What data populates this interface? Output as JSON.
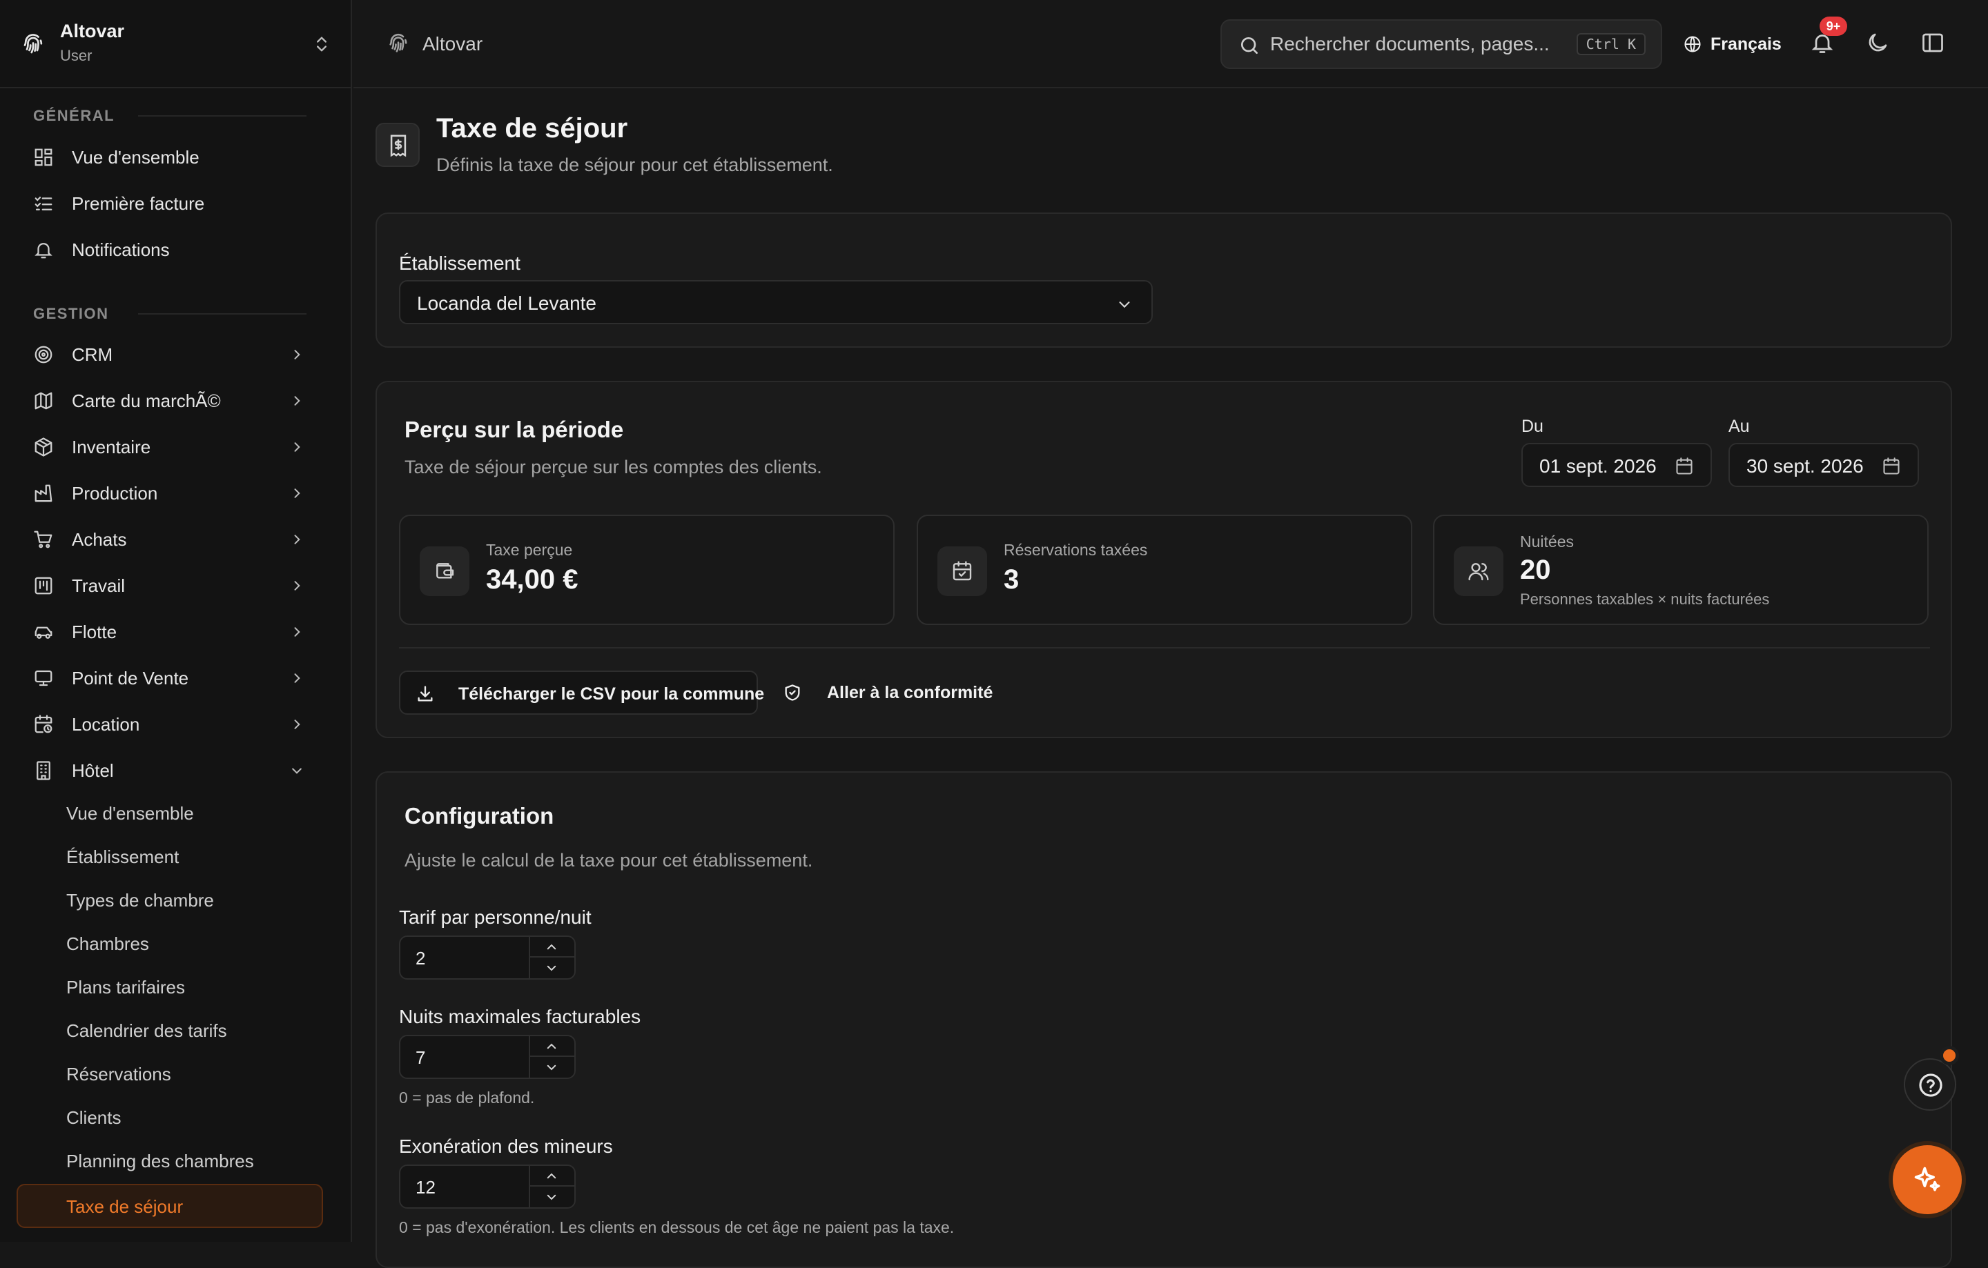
{
  "app": {
    "name": "Altovar",
    "role": "User"
  },
  "sidebar": {
    "sections": [
      {
        "label": "GÉNÉRAL"
      },
      {
        "label": "GESTION"
      }
    ],
    "general": [
      {
        "label": "Vue d'ensemble",
        "icon": "dashboard-icon"
      },
      {
        "label": "Première facture",
        "icon": "checklist-icon"
      },
      {
        "label": "Notifications",
        "icon": "bell-icon"
      }
    ],
    "gestion": [
      {
        "label": "CRM",
        "icon": "target-icon"
      },
      {
        "label": "Carte du marchÃ©",
        "icon": "map-icon"
      },
      {
        "label": "Inventaire",
        "icon": "package-icon"
      },
      {
        "label": "Production",
        "icon": "factory-icon"
      },
      {
        "label": "Achats",
        "icon": "cart-icon"
      },
      {
        "label": "Travail",
        "icon": "kanban-icon"
      },
      {
        "label": "Flotte",
        "icon": "car-icon"
      },
      {
        "label": "Point de Vente",
        "icon": "monitor-icon"
      },
      {
        "label": "Location",
        "icon": "calendar-clock-icon"
      },
      {
        "label": "Hôtel",
        "icon": "building-icon"
      }
    ],
    "hotel_items": [
      {
        "label": "Vue d'ensemble"
      },
      {
        "label": "Établissement"
      },
      {
        "label": "Types de chambre"
      },
      {
        "label": "Chambres"
      },
      {
        "label": "Plans tarifaires"
      },
      {
        "label": "Calendrier des tarifs"
      },
      {
        "label": "Réservations"
      },
      {
        "label": "Clients"
      },
      {
        "label": "Planning des chambres"
      },
      {
        "label": "Taxe de séjour"
      }
    ]
  },
  "topbar": {
    "breadcrumb": "Altovar",
    "search_placeholder": "Rechercher documents, pages...",
    "shortcut": "Ctrl K",
    "language": "Français",
    "notif_badge": "9+"
  },
  "page": {
    "title": "Taxe de séjour",
    "subtitle": "Définis la taxe de séjour pour cet établissement."
  },
  "establishment": {
    "label": "Établissement",
    "value": "Locanda del Levante"
  },
  "period": {
    "title": "Perçu sur la période",
    "subtitle": "Taxe de séjour perçue sur les comptes des clients.",
    "from_label": "Du",
    "from_value": "01 sept. 2026",
    "to_label": "Au",
    "to_value": "30 sept. 2026",
    "stats": [
      {
        "label": "Taxe perçue",
        "value": "34,00 €",
        "icon": "wallet-icon"
      },
      {
        "label": "Réservations taxées",
        "value": "3",
        "icon": "calendar-check-icon"
      },
      {
        "label": "Nuitées",
        "value": "20",
        "hint": "Personnes taxables × nuits facturées",
        "icon": "users-icon"
      }
    ],
    "download_label": "Télécharger le CSV pour la commune",
    "compliance_label": "Aller à la conformité"
  },
  "config": {
    "title": "Configuration",
    "subtitle": "Ajuste le calcul de la taxe pour cet établissement.",
    "fields": [
      {
        "label": "Tarif par personne/nuit",
        "value": "2",
        "hint": ""
      },
      {
        "label": "Nuits maximales facturables",
        "value": "7",
        "hint": "0 = pas de plafond."
      },
      {
        "label": "Exonération des mineurs",
        "value": "12",
        "hint": "0 = pas d'exonération. Les clients en dessous de cet âge ne paient pas la taxe."
      }
    ]
  },
  "colors": {
    "accent": "#e8661c",
    "background": "#171717",
    "badge": "#e5383b"
  }
}
